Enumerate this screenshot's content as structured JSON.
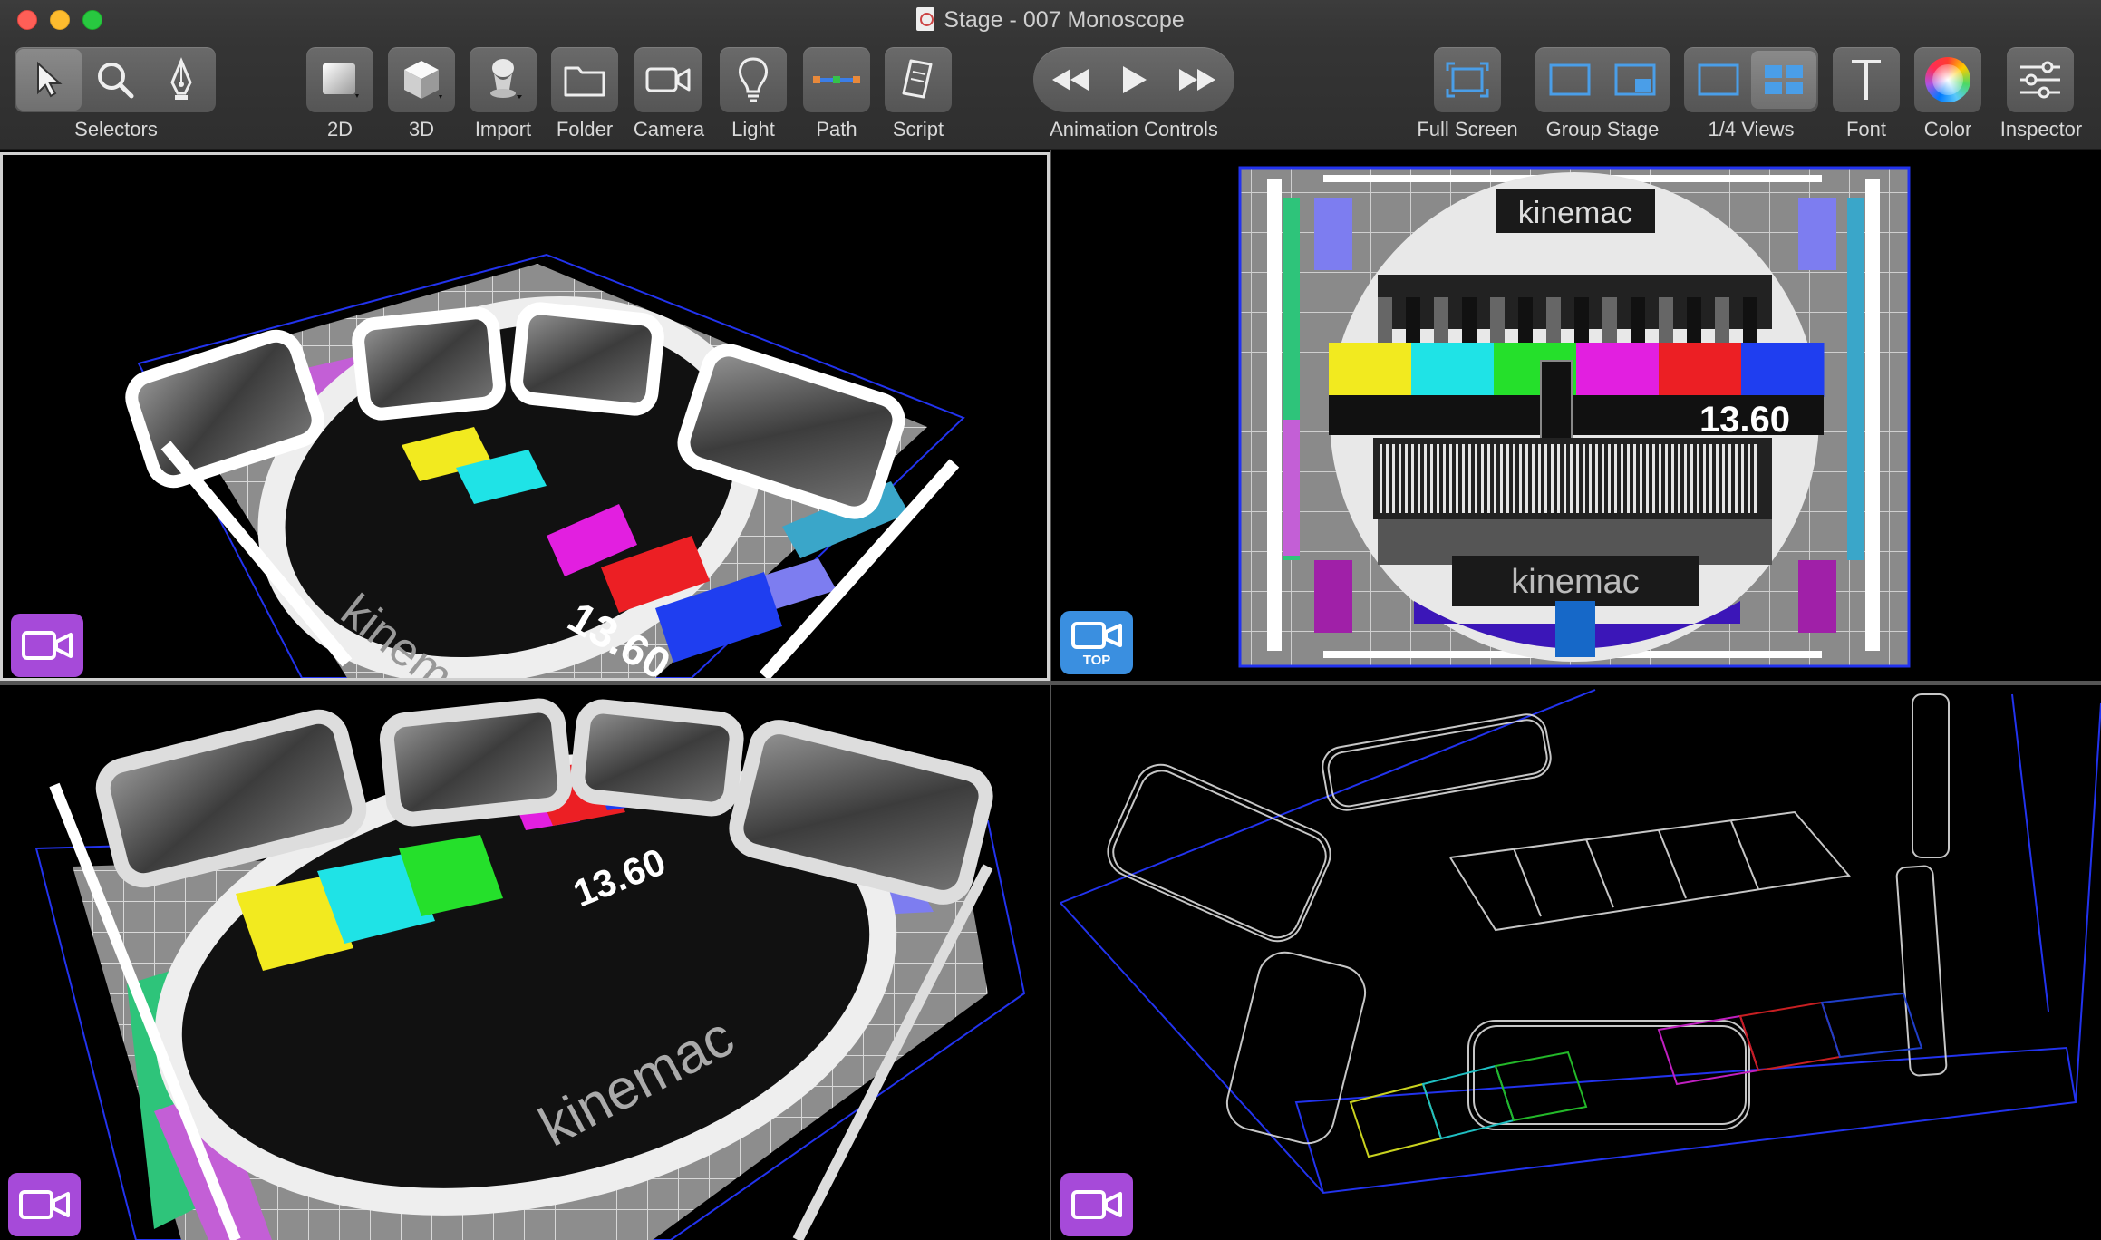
{
  "window": {
    "title": "Stage - 007 Monoscope"
  },
  "toolbar": {
    "selectors_label": "Selectors",
    "d2_label": "2D",
    "d3_label": "3D",
    "import_label": "Import",
    "folder_label": "Folder",
    "camera_label": "Camera",
    "light_label": "Light",
    "path_label": "Path",
    "script_label": "Script",
    "animation_label": "Animation Controls",
    "fullscreen_label": "Full Screen",
    "groupstage_label": "Group Stage",
    "quarterviews_label": "1/4 Views",
    "font_label": "Font",
    "color_label": "Color",
    "inspector_label": "Inspector"
  },
  "viewports": {
    "top_left": {
      "camera": "perspective"
    },
    "top_right": {
      "camera_label": "TOP"
    },
    "bottom_left": {
      "camera": "perspective"
    },
    "bottom_right": {
      "camera": "wireframe"
    }
  },
  "scene": {
    "brand_text": "kinemac",
    "counter_text": "13.60",
    "color_bars": [
      "#f2ea1f",
      "#1fe3e6",
      "#25e02b",
      "#e21fe0",
      "#ec1f24",
      "#1f3ef0"
    ]
  },
  "colors": {
    "accent_blue": "#3a8fe0",
    "camera_purple": "#a64ad9",
    "selected_blue": "#4a9ee8"
  },
  "icons": {
    "arrow": "arrow-pointer-icon",
    "magnifier": "magnifier-icon",
    "pen": "pen-nib-icon",
    "camera": "video-camera-icon",
    "light": "light-bulb-icon"
  }
}
